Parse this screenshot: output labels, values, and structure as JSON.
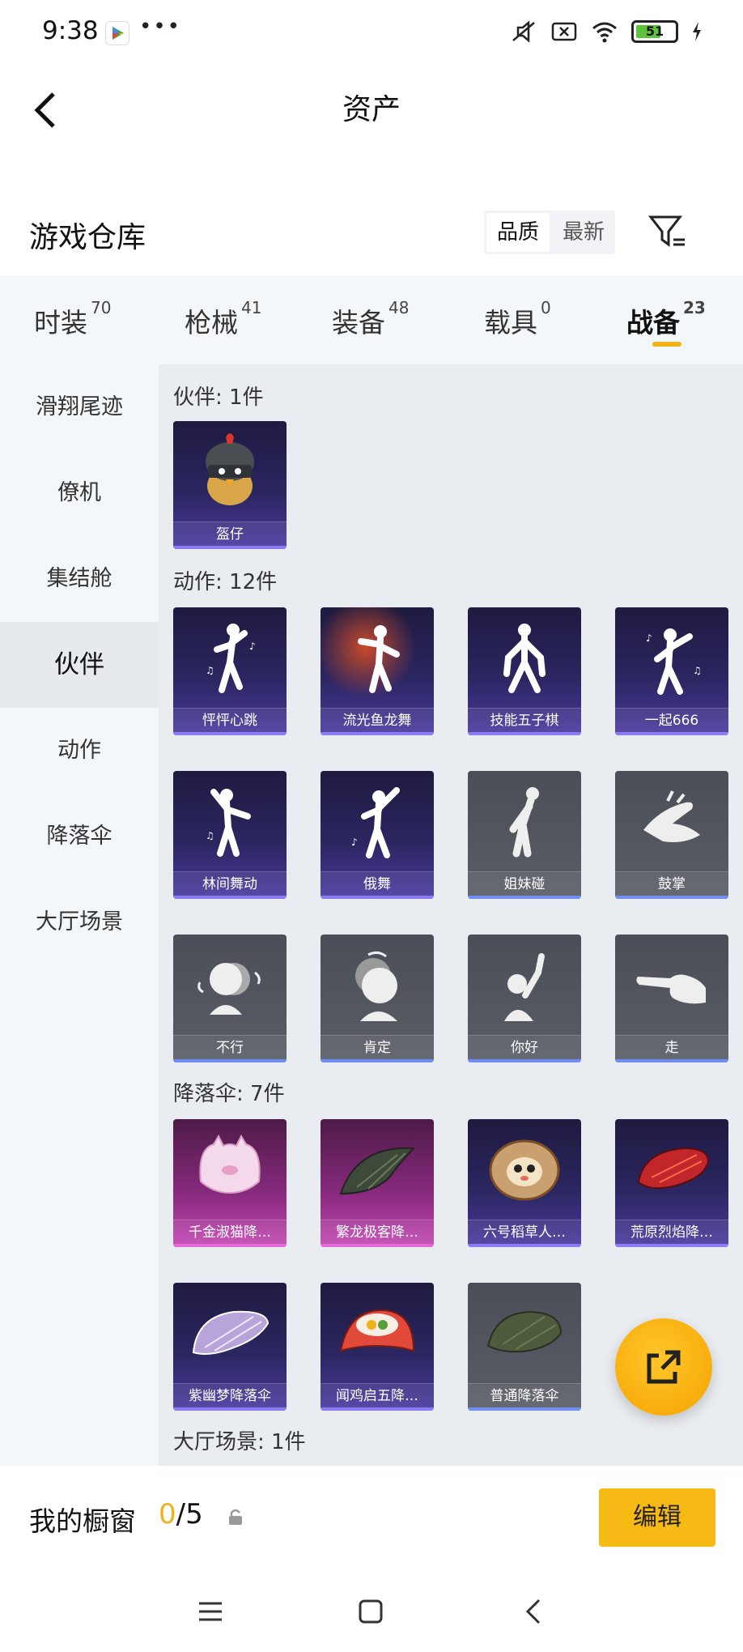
{
  "status_bar": {
    "time": "9:38",
    "more": "•••",
    "battery": "51"
  },
  "header": {
    "title": "资产"
  },
  "warehouse": {
    "title": "游戏仓库",
    "sort_options": [
      "品质",
      "最新"
    ]
  },
  "tabs": [
    {
      "label": "时装",
      "count": "70"
    },
    {
      "label": "枪械",
      "count": "41"
    },
    {
      "label": "装备",
      "count": "48"
    },
    {
      "label": "载具",
      "count": "0"
    },
    {
      "label": "战备",
      "count": "23",
      "active": true
    }
  ],
  "sidebar": {
    "items": [
      "滑翔尾迹",
      "僚机",
      "集结舱",
      "伙伴",
      "动作",
      "降落伞",
      "大厅场景"
    ],
    "active": "伙伴"
  },
  "sections": {
    "partners": {
      "title": "伙伴: 1件",
      "items": [
        {
          "label": "盔仔",
          "quality": "purple",
          "icon": "helmet-chick-icon"
        }
      ]
    },
    "actions": {
      "title": "动作: 12件",
      "items": [
        {
          "label": "怦怦心跳",
          "quality": "purple",
          "icon": "dance-pose-icon"
        },
        {
          "label": "流光鱼龙舞",
          "quality": "purple",
          "icon": "dance-pose-icon"
        },
        {
          "label": "技能五子棋",
          "quality": "purple",
          "icon": "dance-pose-icon"
        },
        {
          "label": "一起666",
          "quality": "purple",
          "icon": "dance-pose-icon"
        },
        {
          "label": "林间舞动",
          "quality": "purple",
          "icon": "dance-pose-icon"
        },
        {
          "label": "俄舞",
          "quality": "purple",
          "icon": "dance-pose-icon"
        },
        {
          "label": "姐妹碰",
          "quality": "gray",
          "icon": "hip-bump-icon"
        },
        {
          "label": "鼓掌",
          "quality": "gray",
          "icon": "clap-hands-icon"
        },
        {
          "label": "不行",
          "quality": "gray",
          "icon": "head-shake-icon"
        },
        {
          "label": "肯定",
          "quality": "gray",
          "icon": "head-nod-icon"
        },
        {
          "label": "你好",
          "quality": "gray",
          "icon": "wave-hand-icon"
        },
        {
          "label": "走",
          "quality": "gray",
          "icon": "point-hand-icon"
        }
      ]
    },
    "parachutes": {
      "title": "降落伞: 7件",
      "items": [
        {
          "label": "千金淑猫降…",
          "quality": "pink",
          "icon": "cat-parachute-icon",
          "color": "#f4d9ec"
        },
        {
          "label": "繁龙极客降…",
          "quality": "pink",
          "icon": "parachute-icon",
          "color": "#3d4a3a"
        },
        {
          "label": "六号稻草人…",
          "quality": "purple",
          "icon": "scarecrow-parachute-icon",
          "color": "#c9a070"
        },
        {
          "label": "荒原烈焰降…",
          "quality": "purple",
          "icon": "parachute-icon",
          "color": "#c0262a"
        },
        {
          "label": "紫幽梦降落伞",
          "quality": "purple",
          "icon": "parachute-icon",
          "color": "#b7a4d8"
        },
        {
          "label": "闻鸡启五降…",
          "quality": "purple",
          "icon": "parachute-icon",
          "color": "#e14a3a"
        },
        {
          "label": "普通降落伞",
          "quality": "gray",
          "icon": "parachute-icon",
          "color": "#4e5a3c"
        }
      ]
    },
    "lobby": {
      "title": "大厅场景: 1件"
    }
  },
  "showcase": {
    "label": "我的橱窗",
    "current": "0",
    "total": "/5",
    "edit_label": "编辑"
  },
  "colors": {
    "accent": "#f2b01b",
    "purple_quality": "#8b7cf6",
    "pink_quality": "#e56ad8",
    "gray_quality": "#6f8ef0"
  }
}
